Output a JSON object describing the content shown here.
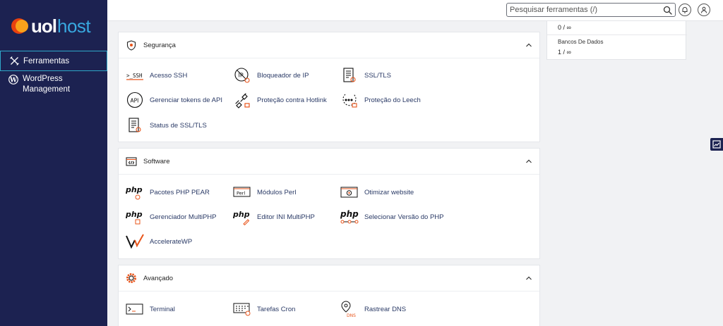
{
  "brand": {
    "logo_word": "uol",
    "logo_suffix": "host"
  },
  "sidebar": {
    "items": [
      {
        "label": "Ferramentas",
        "icon": "tools-icon",
        "active": true
      },
      {
        "label_line1": "WordPress",
        "label_line2": "Management",
        "icon": "wordpress-icon"
      }
    ]
  },
  "topbar": {
    "search": {
      "placeholder": "Pesquisar ferramentas (/)",
      "value": ""
    },
    "notification_icon": "bell-icon",
    "user_icon": "user-icon"
  },
  "stats": {
    "row1_value": "0 / ∞",
    "row2_label": "Bancos De Dados",
    "row2_value": "1 / ∞"
  },
  "panels": {
    "security": {
      "title": "Segurança",
      "tools": [
        "Acesso SSH",
        "Bloqueador de IP",
        "SSL/TLS",
        "Gerenciar tokens de API",
        "Proteção contra Hotlink",
        "Proteção do Leech",
        "Status de SSL/TLS"
      ]
    },
    "software": {
      "title": "Software",
      "tools": [
        "Pacotes PHP PEAR",
        "Módulos Perl",
        "Otimizar website",
        "Gerenciador MultiPHP",
        "Editor INI MultiPHP",
        "Selecionar Versão do PHP",
        "AccelerateWP"
      ]
    },
    "advanced": {
      "title": "Avançado",
      "tools": [
        "Terminal",
        "Tarefas Cron",
        "Rastrear DNS"
      ]
    }
  },
  "icon_text": {
    "ssh": ">_SSH",
    "api": "API",
    "perl": "Perl",
    "php": "php",
    "dns": "DNS"
  },
  "colors": {
    "sidebar_bg": "#1c2251",
    "accent_orange": "#e8541a",
    "link_text": "#2a3a66",
    "active_border": "#2fa7c9"
  }
}
